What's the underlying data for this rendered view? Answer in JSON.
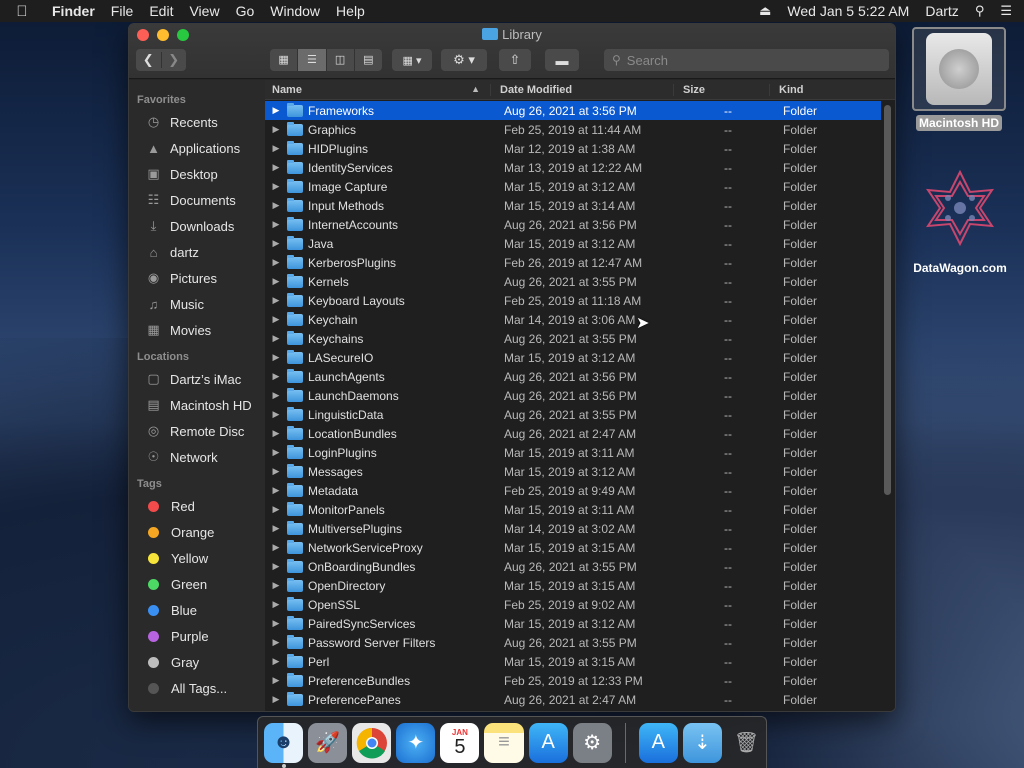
{
  "menubar": {
    "app_name": "Finder",
    "menus": [
      "File",
      "Edit",
      "View",
      "Go",
      "Window",
      "Help"
    ],
    "datetime": "Wed Jan 5  5:22 AM",
    "user": "Dartz"
  },
  "window": {
    "title": "Library",
    "search_placeholder": "Search"
  },
  "sidebar": {
    "favorites_header": "Favorites",
    "favorites": [
      {
        "label": "Recents",
        "icon": "clock-icon"
      },
      {
        "label": "Applications",
        "icon": "applications-icon"
      },
      {
        "label": "Desktop",
        "icon": "desktop-icon"
      },
      {
        "label": "Documents",
        "icon": "documents-icon"
      },
      {
        "label": "Downloads",
        "icon": "downloads-icon"
      },
      {
        "label": "dartz",
        "icon": "home-icon"
      },
      {
        "label": "Pictures",
        "icon": "camera-icon"
      },
      {
        "label": "Music",
        "icon": "music-icon"
      },
      {
        "label": "Movies",
        "icon": "film-icon"
      }
    ],
    "locations_header": "Locations",
    "locations": [
      {
        "label": "Dartz’s iMac",
        "icon": "imac-icon"
      },
      {
        "label": "Macintosh HD",
        "icon": "disk-icon"
      },
      {
        "label": "Remote Disc",
        "icon": "disc-icon"
      },
      {
        "label": "Network",
        "icon": "globe-icon"
      }
    ],
    "tags_header": "Tags",
    "tags": [
      {
        "label": "Red",
        "color": "#f24b4b"
      },
      {
        "label": "Orange",
        "color": "#f5a623"
      },
      {
        "label": "Yellow",
        "color": "#f7e43a"
      },
      {
        "label": "Green",
        "color": "#4cd964"
      },
      {
        "label": "Blue",
        "color": "#3a8ff2"
      },
      {
        "label": "Purple",
        "color": "#b864e0"
      },
      {
        "label": "Gray",
        "color": "#bdbdbd"
      },
      {
        "label": "All Tags...",
        "color": "#555555"
      }
    ]
  },
  "columns": {
    "name": "Name",
    "date": "Date Modified",
    "size": "Size",
    "kind": "Kind"
  },
  "rows": [
    {
      "name": "Frameworks",
      "date": "Aug 26, 2021 at 3:56 PM",
      "size": "--",
      "kind": "Folder"
    },
    {
      "name": "Graphics",
      "date": "Feb 25, 2019 at 11:44 AM",
      "size": "--",
      "kind": "Folder"
    },
    {
      "name": "HIDPlugins",
      "date": "Mar 12, 2019 at 1:38 AM",
      "size": "--",
      "kind": "Folder"
    },
    {
      "name": "IdentityServices",
      "date": "Mar 13, 2019 at 12:22 AM",
      "size": "--",
      "kind": "Folder"
    },
    {
      "name": "Image Capture",
      "date": "Mar 15, 2019 at 3:12 AM",
      "size": "--",
      "kind": "Folder"
    },
    {
      "name": "Input Methods",
      "date": "Mar 15, 2019 at 3:14 AM",
      "size": "--",
      "kind": "Folder"
    },
    {
      "name": "InternetAccounts",
      "date": "Aug 26, 2021 at 3:56 PM",
      "size": "--",
      "kind": "Folder"
    },
    {
      "name": "Java",
      "date": "Mar 15, 2019 at 3:12 AM",
      "size": "--",
      "kind": "Folder"
    },
    {
      "name": "KerberosPlugins",
      "date": "Feb 26, 2019 at 12:47 AM",
      "size": "--",
      "kind": "Folder"
    },
    {
      "name": "Kernels",
      "date": "Aug 26, 2021 at 3:55 PM",
      "size": "--",
      "kind": "Folder"
    },
    {
      "name": "Keyboard Layouts",
      "date": "Feb 25, 2019 at 11:18 AM",
      "size": "--",
      "kind": "Folder"
    },
    {
      "name": "Keychain",
      "date": "Mar 14, 2019 at 3:06 AM",
      "size": "--",
      "kind": "Folder"
    },
    {
      "name": "Keychains",
      "date": "Aug 26, 2021 at 3:55 PM",
      "size": "--",
      "kind": "Folder"
    },
    {
      "name": "LASecureIO",
      "date": "Mar 15, 2019 at 3:12 AM",
      "size": "--",
      "kind": "Folder"
    },
    {
      "name": "LaunchAgents",
      "date": "Aug 26, 2021 at 3:56 PM",
      "size": "--",
      "kind": "Folder"
    },
    {
      "name": "LaunchDaemons",
      "date": "Aug 26, 2021 at 3:56 PM",
      "size": "--",
      "kind": "Folder"
    },
    {
      "name": "LinguisticData",
      "date": "Aug 26, 2021 at 3:55 PM",
      "size": "--",
      "kind": "Folder"
    },
    {
      "name": "LocationBundles",
      "date": "Aug 26, 2021 at 2:47 AM",
      "size": "--",
      "kind": "Folder"
    },
    {
      "name": "LoginPlugins",
      "date": "Mar 15, 2019 at 3:11 AM",
      "size": "--",
      "kind": "Folder"
    },
    {
      "name": "Messages",
      "date": "Mar 15, 2019 at 3:12 AM",
      "size": "--",
      "kind": "Folder"
    },
    {
      "name": "Metadata",
      "date": "Feb 25, 2019 at 9:49 AM",
      "size": "--",
      "kind": "Folder"
    },
    {
      "name": "MonitorPanels",
      "date": "Mar 15, 2019 at 3:11 AM",
      "size": "--",
      "kind": "Folder"
    },
    {
      "name": "MultiversePlugins",
      "date": "Mar 14, 2019 at 3:02 AM",
      "size": "--",
      "kind": "Folder"
    },
    {
      "name": "NetworkServiceProxy",
      "date": "Mar 15, 2019 at 3:15 AM",
      "size": "--",
      "kind": "Folder"
    },
    {
      "name": "OnBoardingBundles",
      "date": "Aug 26, 2021 at 3:55 PM",
      "size": "--",
      "kind": "Folder"
    },
    {
      "name": "OpenDirectory",
      "date": "Mar 15, 2019 at 3:15 AM",
      "size": "--",
      "kind": "Folder"
    },
    {
      "name": "OpenSSL",
      "date": "Feb 25, 2019 at 9:02 AM",
      "size": "--",
      "kind": "Folder"
    },
    {
      "name": "PairedSyncServices",
      "date": "Mar 15, 2019 at 3:12 AM",
      "size": "--",
      "kind": "Folder"
    },
    {
      "name": "Password Server Filters",
      "date": "Aug 26, 2021 at 3:55 PM",
      "size": "--",
      "kind": "Folder"
    },
    {
      "name": "Perl",
      "date": "Mar 15, 2019 at 3:15 AM",
      "size": "--",
      "kind": "Folder"
    },
    {
      "name": "PreferenceBundles",
      "date": "Feb 25, 2019 at 12:33 PM",
      "size": "--",
      "kind": "Folder"
    },
    {
      "name": "PreferencePanes",
      "date": "Aug 26, 2021 at 2:47 AM",
      "size": "--",
      "kind": "Folder"
    }
  ],
  "desktop": {
    "hd_label": "Macintosh HD",
    "datawagon_label": "DataWagon.com"
  },
  "dock": {
    "calendar_month": "JAN",
    "calendar_day": "5",
    "apps": [
      "finder-icon",
      "launchpad-icon",
      "chrome-icon",
      "safari-icon",
      "calendar-icon",
      "notes-icon",
      "app-store-icon",
      "system-preferences-icon",
      "applications-folder-icon",
      "downloads-folder-icon",
      "trash-icon"
    ]
  }
}
